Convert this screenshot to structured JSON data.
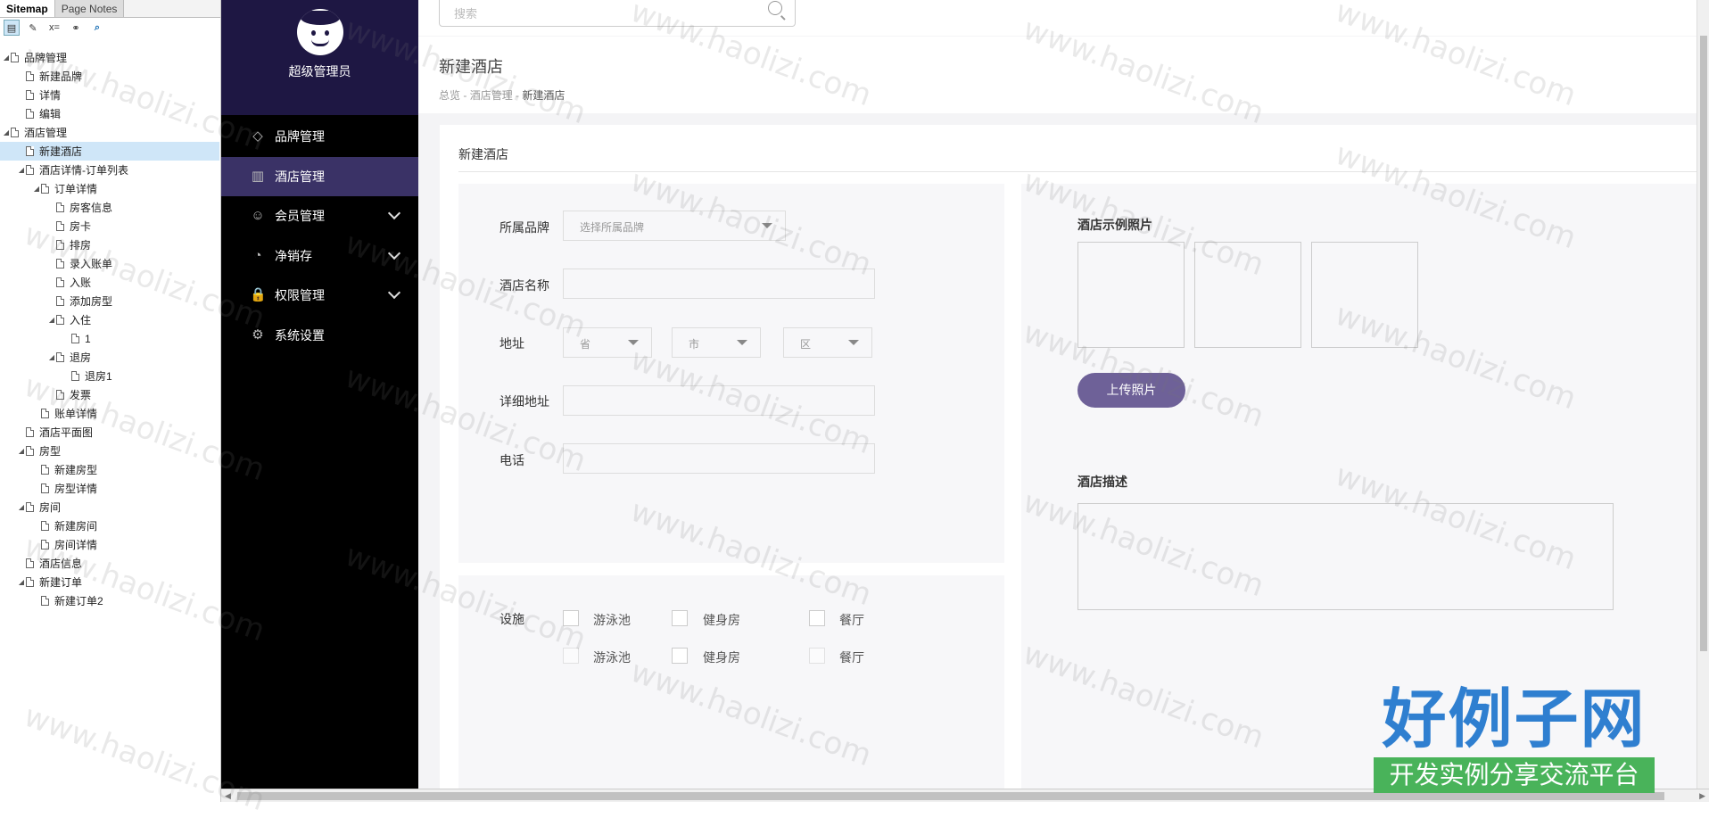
{
  "sitemap": {
    "tabs": [
      "Sitemap",
      "Page Notes"
    ],
    "tree": [
      {
        "label": "品牌管理",
        "level": 0,
        "expanded": true
      },
      {
        "label": "新建品牌",
        "level": 1
      },
      {
        "label": "详情",
        "level": 1
      },
      {
        "label": "编辑",
        "level": 1
      },
      {
        "label": "酒店管理",
        "level": 0,
        "expanded": true
      },
      {
        "label": "新建酒店",
        "level": 1,
        "selected": true
      },
      {
        "label": "酒店详情-订单列表",
        "level": 1,
        "expanded": true
      },
      {
        "label": "订单详情",
        "level": 2,
        "expanded": true
      },
      {
        "label": "房客信息",
        "level": 3
      },
      {
        "label": "房卡",
        "level": 3
      },
      {
        "label": "排房",
        "level": 3
      },
      {
        "label": "录入账单",
        "level": 3
      },
      {
        "label": "入账",
        "level": 3
      },
      {
        "label": "添加房型",
        "level": 3
      },
      {
        "label": "入住",
        "level": 3,
        "expanded": true
      },
      {
        "label": "1",
        "level": 4
      },
      {
        "label": "退房",
        "level": 3,
        "expanded": true
      },
      {
        "label": "退房1",
        "level": 4
      },
      {
        "label": "发票",
        "level": 3
      },
      {
        "label": "账单详情",
        "level": 2
      },
      {
        "label": "酒店平面图",
        "level": 1
      },
      {
        "label": "房型",
        "level": 1,
        "expanded": true
      },
      {
        "label": "新建房型",
        "level": 2
      },
      {
        "label": "房型详情",
        "level": 2
      },
      {
        "label": "房间",
        "level": 1,
        "expanded": true
      },
      {
        "label": "新建房间",
        "level": 2
      },
      {
        "label": "房间详情",
        "level": 2
      },
      {
        "label": "酒店信息",
        "level": 1
      },
      {
        "label": "新建订单",
        "level": 1,
        "expanded": true
      },
      {
        "label": "新建订单2",
        "level": 2
      }
    ]
  },
  "user": {
    "name": "超级管理员"
  },
  "menu": [
    {
      "label": "品牌管理",
      "icon": "diamond-icon",
      "active": false,
      "expandable": false
    },
    {
      "label": "酒店管理",
      "icon": "building-icon",
      "active": true,
      "expandable": false
    },
    {
      "label": "会员管理",
      "icon": "member-icon",
      "active": false,
      "expandable": true
    },
    {
      "label": "净销存",
      "icon": "pie-icon",
      "active": false,
      "expandable": true
    },
    {
      "label": "权限管理",
      "icon": "lock-icon",
      "active": false,
      "expandable": true
    },
    {
      "label": "系统设置",
      "icon": "gear-icon",
      "active": false,
      "expandable": false
    }
  ],
  "search": {
    "placeholder": "搜索"
  },
  "page": {
    "title": "新建酒店",
    "breadcrumb": [
      "总览",
      "酒店管理",
      "新建酒店"
    ],
    "card_title": "新建酒店"
  },
  "form": {
    "brand_label": "所属品牌",
    "brand_placeholder": "选择所属品牌",
    "name_label": "酒店名称",
    "address_label": "地址",
    "province": "省",
    "city": "市",
    "district": "区",
    "detail_label": "详细地址",
    "phone_label": "电话",
    "facilities_label": "设施",
    "facilities": [
      [
        "游泳池",
        "健身房",
        "餐厅"
      ],
      [
        "游泳池",
        "健身房",
        "餐厅"
      ]
    ],
    "photos_label": "酒店示例照片",
    "upload_label": "上传照片",
    "desc_label": "酒店描述"
  },
  "watermark": {
    "text": "www.haolizi.com"
  },
  "logo": {
    "title": "好例子网",
    "subtitle": "开发实例分享交流平台"
  }
}
